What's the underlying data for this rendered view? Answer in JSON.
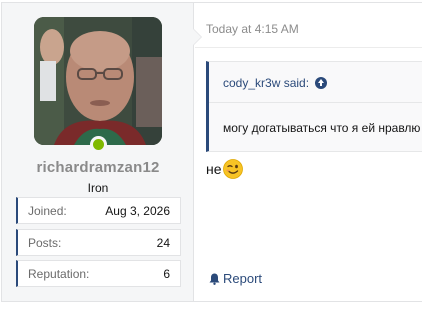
{
  "post": {
    "user": {
      "username": "richardramzan12",
      "user_title": "Iron",
      "online": true,
      "stats": [
        {
          "label": "Joined:",
          "value": "Aug 3, 2026"
        },
        {
          "label": "Posts:",
          "value": "24"
        },
        {
          "label": "Reputation:",
          "value": "6"
        }
      ]
    },
    "date": "Today at 4:15 AM",
    "quote": {
      "author": "cody_kr3w said:",
      "text": "могу догатываться что я ей нравлю"
    },
    "message": "не",
    "actions": {
      "report_label": "Report"
    }
  },
  "colors": {
    "accent": "#2b4a7a",
    "online": "#7fb900",
    "username": "#8a8a8a",
    "user_cell_bg": "#f5f6f7"
  },
  "icons": {
    "quote_jump": "up-arrow-circle-icon",
    "report": "bell-icon",
    "emoji": "wink-emoji-icon"
  }
}
